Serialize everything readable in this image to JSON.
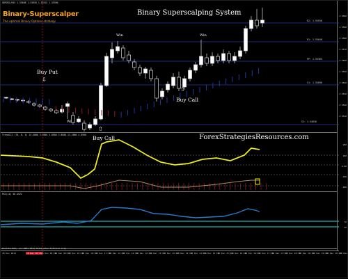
{
  "symbol_info": "GBPUSD,M15  1.55608 1.55650 1.55515 1.55566",
  "brand": {
    "name": "Binary-Superscalper",
    "tagline": "The optimal Binary Options strategy"
  },
  "system_title": "Binary Superscalping System",
  "website": "ForexStrategiesResources.com",
  "signals": {
    "buy_put": "Buy Put",
    "buy_call_1": "Buy Call",
    "buy_call_2": "Buy Call"
  },
  "win_label": "Win",
  "levels": {
    "r2": "R2: 1.55930",
    "r1": "R1: 1.55640",
    "pp": "PP: 1.55365",
    "s1": "S1: 1.55090",
    "s2": "S2: 1.54830"
  },
  "trend_title": "TrendCCI  (70, 8, 4)  14.4086 3.8900 3.8900 3.8900 13.4086 4.8900",
  "rsi_title": "RSI(14) 58.4522",
  "copyright": "Pallita M15, (c) 2001-2014 MetaQuotes Software Corp.",
  "price_ticks": [
    "1.5600",
    "1.5590",
    "1.5580",
    "1.5570",
    "1.5560",
    "1.5550",
    "1.5540",
    "1.5530",
    "1.5520",
    "1.5510"
  ],
  "trend_ticks": [
    "200",
    "100",
    "0.00",
    "-100",
    "-200"
  ],
  "rsi_ticks": [
    "70",
    "30"
  ],
  "time_labels": [
    "18 Dec 2014",
    "18 Dec 09:15",
    "18 Dec 09:45",
    "18 Dec 10:15",
    "18 Dec 10:45",
    "18 Dec 11:15",
    "18 Dec 11:45",
    "18 Dec 12:15",
    "18 Dec 12:45",
    "18 Dec 13:15",
    "18 Dec 13:45",
    "18 Dec 14:15",
    "18 Dec 14:45",
    "18 Dec 15:15",
    "18 Dec 15:45",
    "18 Dec 16:15",
    "18 Dec 16:45",
    "18 Dec 17:15",
    "18 Dec 17:45",
    "18 Dec 18:15",
    "18 Dec 18:45",
    "18 Dec 19:15",
    "18 Dec 19:45",
    "18 Dec 20:15"
  ],
  "time_highlight": "18 Dec 08:45",
  "colors": {
    "bull": "#ffffff",
    "bear": "#d9d9d9",
    "level": "#1f3aa8",
    "trend": "#ecec1e",
    "trend_signal": "#b08a5a",
    "hist": "#8c1b22",
    "rsi": "#2b78c8",
    "rsi_band": "#18b3b3"
  }
}
